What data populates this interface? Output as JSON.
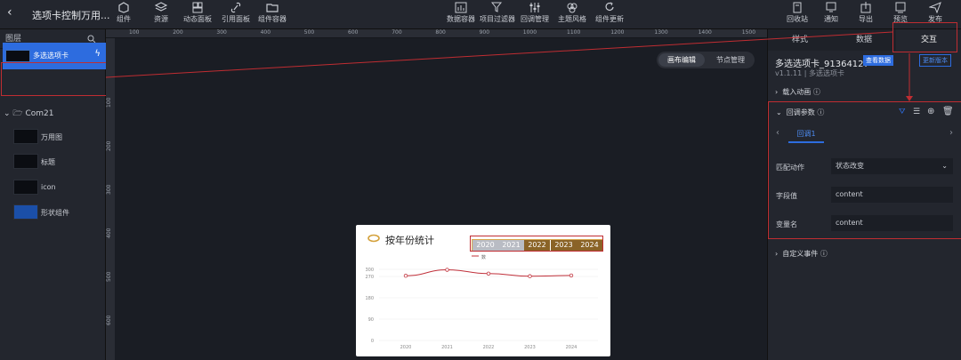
{
  "app": {
    "back_icon": "back-arrow-icon",
    "title": "选项卡控制万用..."
  },
  "toolbar": {
    "left": [
      {
        "label": "组件",
        "icon": "component-icon"
      },
      {
        "label": "资源",
        "icon": "layers-icon"
      },
      {
        "label": "动态面板",
        "icon": "panel-icon"
      },
      {
        "label": "引用面板",
        "icon": "link-icon"
      },
      {
        "label": "组件容器",
        "icon": "folder-icon"
      }
    ],
    "center": [
      {
        "label": "数据容器",
        "icon": "chart-icon"
      },
      {
        "label": "项目过滤器",
        "icon": "filter-icon"
      },
      {
        "label": "回调管理",
        "icon": "sliders-icon"
      },
      {
        "label": "主题风格",
        "icon": "palette-icon"
      },
      {
        "label": "组件更新",
        "icon": "refresh-icon"
      }
    ],
    "right": [
      {
        "label": "回收站",
        "icon": "trash-icon"
      },
      {
        "label": "通知",
        "icon": "bell-icon"
      },
      {
        "label": "导出",
        "icon": "export-icon"
      },
      {
        "label": "预览",
        "icon": "preview-icon"
      },
      {
        "label": "发布",
        "icon": "send-icon"
      }
    ]
  },
  "layers": {
    "title": "图层",
    "selected": {
      "name": "多选选项卡"
    },
    "group": {
      "name": "Com21"
    },
    "children": [
      {
        "name": "万用图"
      },
      {
        "name": "标题"
      },
      {
        "name": "icon"
      },
      {
        "name": "形状组件"
      }
    ]
  },
  "ruler": {
    "top": [
      "100",
      "200",
      "300",
      "400",
      "500",
      "600",
      "700",
      "800",
      "900",
      "1000",
      "1100",
      "1200",
      "1300",
      "1400",
      "1500"
    ],
    "left": [
      "100",
      "200",
      "300",
      "400",
      "500",
      "600"
    ]
  },
  "canvas_mode": {
    "edit": "画布编辑",
    "node": "节点管理"
  },
  "widget": {
    "title": "按年份统计",
    "years": [
      "2020",
      "2021",
      "2022",
      "2023",
      "2024"
    ],
    "legend": "数"
  },
  "chart_data": {
    "type": "line",
    "categories": [
      "2020",
      "2021",
      "2022",
      "2023",
      "2024"
    ],
    "series": [
      {
        "name": "数",
        "values": [
          273,
          298,
          282,
          271,
          274
        ]
      }
    ],
    "ylim": [
      0,
      300
    ],
    "yticks": [
      "0",
      "90",
      "180",
      "270",
      "300"
    ],
    "line_color": "#c0303a"
  },
  "right": {
    "tabs": [
      "样式",
      "数据",
      "交互"
    ],
    "component_name": "多选选项卡_91364127",
    "view_data": "查看数据",
    "update_version": "更新版本",
    "version": "v1.1.11 | 多选选项卡",
    "load_anim": "载入动画",
    "callback": "回调参数",
    "subtab": "回调1",
    "rows": [
      {
        "label": "匹配动作",
        "value": "状态改变"
      },
      {
        "label": "字段值",
        "value": "content"
      },
      {
        "label": "变量名",
        "value": "content"
      }
    ],
    "custom_event": "自定义事件"
  },
  "colors": {
    "accent": "#2d6cdf",
    "highlight": "#c02d32"
  }
}
